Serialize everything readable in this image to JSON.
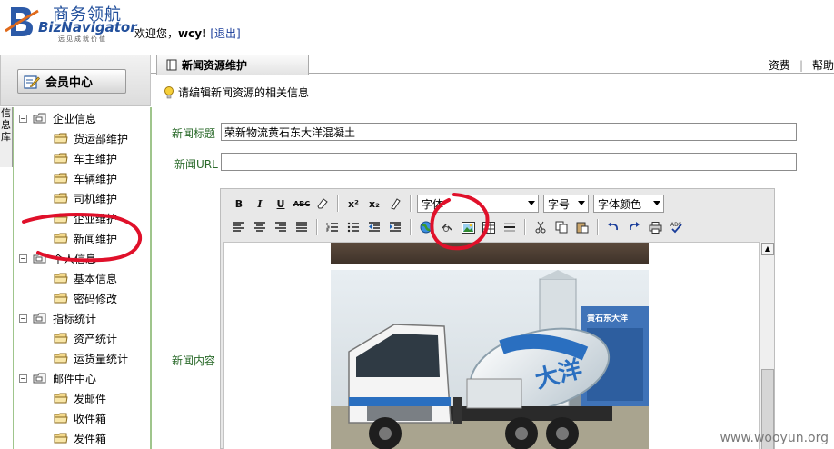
{
  "header": {
    "logo_cn": "商务领航",
    "logo_en": "BizNavigator",
    "logo_sub": "远见成就价值",
    "welcome_prefix": "欢迎您，",
    "username": "wcy!",
    "logout": "[退出]"
  },
  "sidebar": {
    "member_center": "会员中心",
    "vertical_tab": "信息库",
    "groups": [
      {
        "label": "企业信息",
        "items": [
          "货运部维护",
          "车主维护",
          "车辆维护",
          "司机维护",
          "企业维护",
          "新闻维护"
        ]
      },
      {
        "label": "个人信息",
        "items": [
          "基本信息",
          "密码修改"
        ]
      },
      {
        "label": "指标统计",
        "items": [
          "资产统计",
          "运货量统计"
        ]
      },
      {
        "label": "邮件中心",
        "items": [
          "发邮件",
          "收件箱",
          "发件箱"
        ]
      }
    ]
  },
  "tab": {
    "label": "新闻资源维护"
  },
  "top_links": [
    "资费",
    "帮助"
  ],
  "hint": "请编辑新闻资源的相关信息",
  "form": {
    "title_label": "新闻标题",
    "title_value": "荣新物流黄石东大洋混凝土",
    "url_label": "新闻URL",
    "url_value": "",
    "content_label": "新闻内容"
  },
  "editor": {
    "font_family": "字体",
    "font_size": "字号",
    "font_color": "字体颜色"
  },
  "image": {
    "truck_text": "大洋",
    "plant_text": "黄石东大洋"
  },
  "watermark": "www.wooyun.org"
}
